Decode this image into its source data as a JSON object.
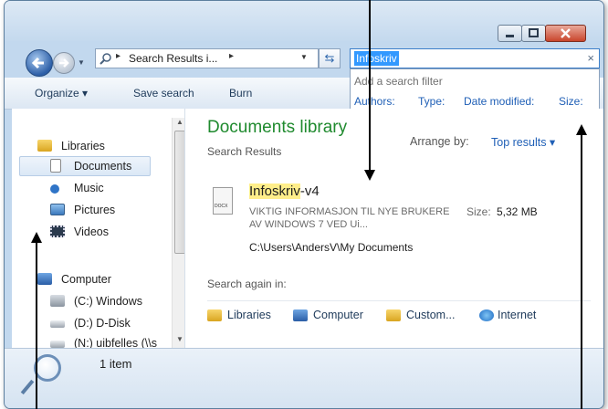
{
  "window": {
    "caption_buttons": [
      "minimize-icon",
      "maximize-icon",
      "close-icon"
    ]
  },
  "nav": {
    "address": "Search Results i...",
    "address_separator_left": "▸",
    "address_separator_right": "▸",
    "search_query": "Infoskriv",
    "search_clear": "×"
  },
  "filter": {
    "title": "Add a search filter",
    "options": [
      "Authors:",
      "Type:",
      "Date modified:",
      "Size:"
    ]
  },
  "toolbar": {
    "organize": "Organize ▾",
    "save_search": "Save search",
    "burn": "Burn"
  },
  "sidebar": {
    "libraries": "Libraries",
    "documents": "Documents",
    "music": "Music",
    "pictures": "Pictures",
    "videos": "Videos",
    "computer": "Computer",
    "drive_c": "(C:) Windows",
    "drive_d": "(D:) D-Disk",
    "drive_n": "(N:) uibfelles (\\\\s"
  },
  "content": {
    "title": "Documents library",
    "subtitle": "Search Results",
    "arrange_label": "Arrange by:",
    "arrange_value": "Top results ▾",
    "result": {
      "icon_label": "DOCX",
      "name_highlight": "Infoskriv",
      "name_rest": "-v4",
      "snippet": "VIKTIG INFORMASJON TIL NYE BRUKERE AV WINDOWS 7 VED Ui...",
      "size_label": "Size:",
      "size": "5,32 MB",
      "path": "C:\\Users\\AndersV\\My Documents"
    },
    "search_again_label": "Search again in:",
    "search_again": [
      "Libraries",
      "Computer",
      "Custom...",
      "Internet"
    ]
  },
  "details": {
    "count": "1 item"
  },
  "colors": {
    "library_title": "#1f8a2e",
    "link": "#1f5fb6",
    "highlight": "#ffee8a",
    "selection": "#3399ff"
  }
}
